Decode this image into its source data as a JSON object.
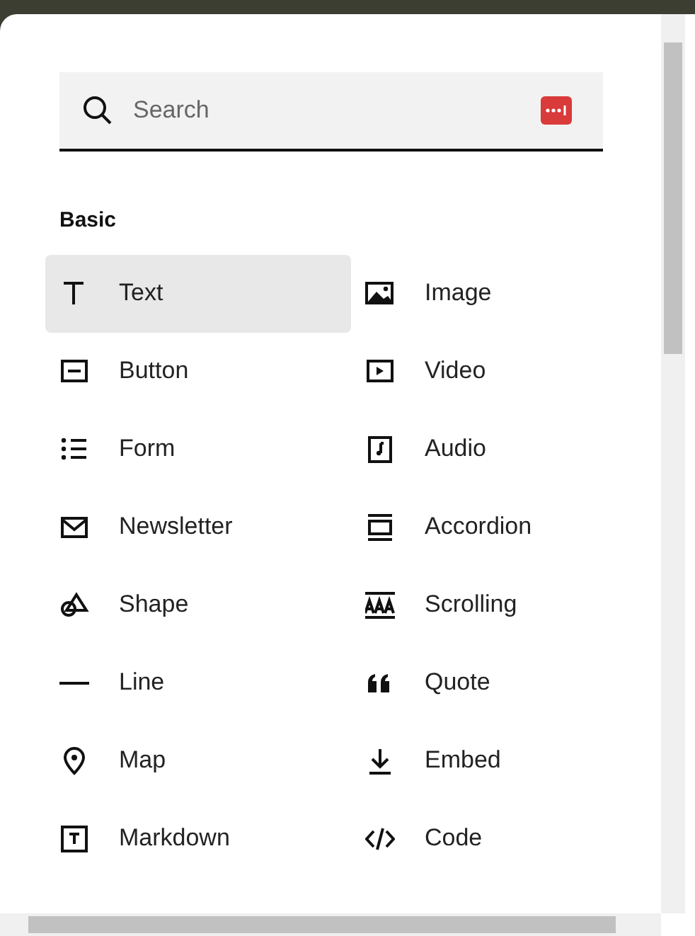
{
  "search": {
    "placeholder": "Search"
  },
  "sections": [
    {
      "title": "Basic",
      "items": [
        {
          "kind": "text",
          "label": "Text",
          "selected": true
        },
        {
          "kind": "image",
          "label": "Image",
          "selected": false
        },
        {
          "kind": "button",
          "label": "Button",
          "selected": false
        },
        {
          "kind": "video",
          "label": "Video",
          "selected": false
        },
        {
          "kind": "form",
          "label": "Form",
          "selected": false
        },
        {
          "kind": "audio",
          "label": "Audio",
          "selected": false
        },
        {
          "kind": "newsletter",
          "label": "Newsletter",
          "selected": false
        },
        {
          "kind": "accordion",
          "label": "Accordion",
          "selected": false
        },
        {
          "kind": "shape",
          "label": "Shape",
          "selected": false
        },
        {
          "kind": "scrolling",
          "label": "Scrolling",
          "selected": false
        },
        {
          "kind": "line",
          "label": "Line",
          "selected": false
        },
        {
          "kind": "quote",
          "label": "Quote",
          "selected": false
        },
        {
          "kind": "map",
          "label": "Map",
          "selected": false
        },
        {
          "kind": "embed",
          "label": "Embed",
          "selected": false
        },
        {
          "kind": "markdown",
          "label": "Markdown",
          "selected": false
        },
        {
          "kind": "code",
          "label": "Code",
          "selected": false
        }
      ]
    }
  ]
}
